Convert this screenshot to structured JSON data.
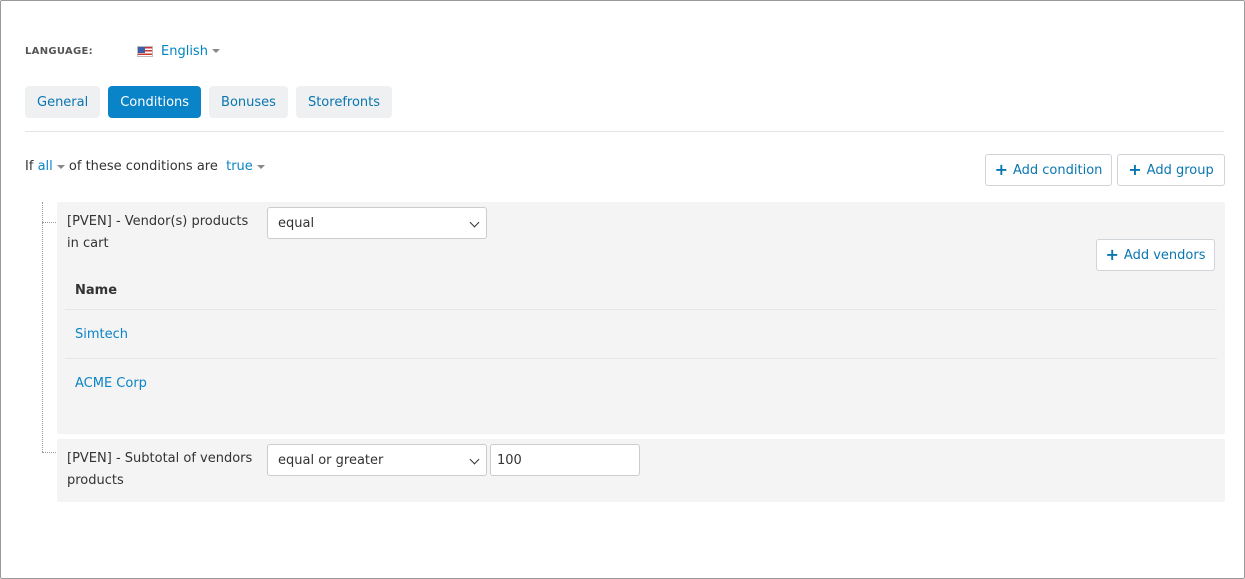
{
  "language": {
    "label": "LANGUAGE:",
    "value": "English",
    "flag_icon": "us-flag-icon"
  },
  "tabs": [
    {
      "label": "General",
      "active": false
    },
    {
      "label": "Conditions",
      "active": true
    },
    {
      "label": "Bonuses",
      "active": false
    },
    {
      "label": "Storefronts",
      "active": false
    }
  ],
  "conditions_header": {
    "prefix": "If",
    "quantifier": "all",
    "middle": "of these conditions are",
    "truth": "true",
    "add_condition_label": "Add condition",
    "add_group_label": "Add group"
  },
  "condition1": {
    "label": "[PVEN] - Vendor(s) products in cart",
    "operator": "equal",
    "add_vendors_label": "Add vendors",
    "table_header": "Name",
    "vendors": [
      "Simtech",
      "ACME Corp"
    ]
  },
  "condition2": {
    "label": "[PVEN] - Subtotal of vendors products",
    "operator": "equal or greater",
    "value": "100"
  },
  "colors": {
    "accent": "#0a84c8",
    "panel_bg": "#f4f4f4",
    "tab_bg": "#eef0f2"
  }
}
